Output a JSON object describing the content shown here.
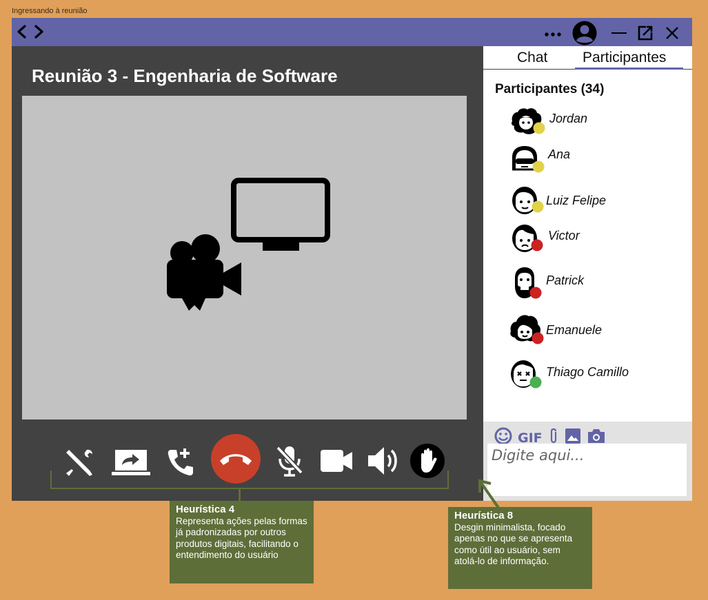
{
  "frame_label": "Ingressando à reunião",
  "meeting": {
    "title": "Reunião 3 - Engenharia de Software"
  },
  "tabs": {
    "chat": "Chat",
    "participants": "Participantes"
  },
  "participants": {
    "heading": "Participantes (34)",
    "items": [
      {
        "name": "Jordan",
        "status": "yellow",
        "status_color": "#E2D24A"
      },
      {
        "name": "Ana",
        "status": "yellow",
        "status_color": "#E2D24A"
      },
      {
        "name": "Luiz Felipe",
        "status": "yellow",
        "status_color": "#E2D24A"
      },
      {
        "name": "Victor",
        "status": "red",
        "status_color": "#CC2222"
      },
      {
        "name": "Patrick",
        "status": "red",
        "status_color": "#CC2222"
      },
      {
        "name": "Emanuele",
        "status": "red",
        "status_color": "#CC2222"
      },
      {
        "name": "Thiago Camillo",
        "status": "green",
        "status_color": "#4CAF50"
      }
    ]
  },
  "composer": {
    "placeholder": "Digite aqui...",
    "gif_label": "GIF"
  },
  "notes": {
    "h4_title": "Heurística 4",
    "h4_body": "Representa ações pelas formas já padronizadas por outros produtos digitais, facilitando o entendimento do usuário",
    "h8_title": "Heurística 8",
    "h8_body": "Desgin minimalista, focado apenas no que se apresenta como útil ao usuário, sem atolá-lo de informação."
  },
  "colors": {
    "background": "#E0A05A",
    "titlebar": "#6264A7",
    "meeting_panel": "#424242",
    "stage": "#C2C2C2",
    "hangup": "#C8402A",
    "annotation": "#5E6E39"
  },
  "icons": {
    "titlebar": [
      "back-icon",
      "forward-icon",
      "more-icon",
      "account-icon",
      "minimize-icon",
      "popout-icon",
      "close-icon"
    ],
    "controls": [
      "tools-icon",
      "share-screen-icon",
      "add-call-icon",
      "hang-up-icon",
      "mic-off-icon",
      "camera-icon",
      "volume-icon",
      "raise-hand-icon"
    ],
    "composer": [
      "emoji-icon",
      "gif-icon",
      "attach-icon",
      "image-icon",
      "camera-icon"
    ]
  }
}
